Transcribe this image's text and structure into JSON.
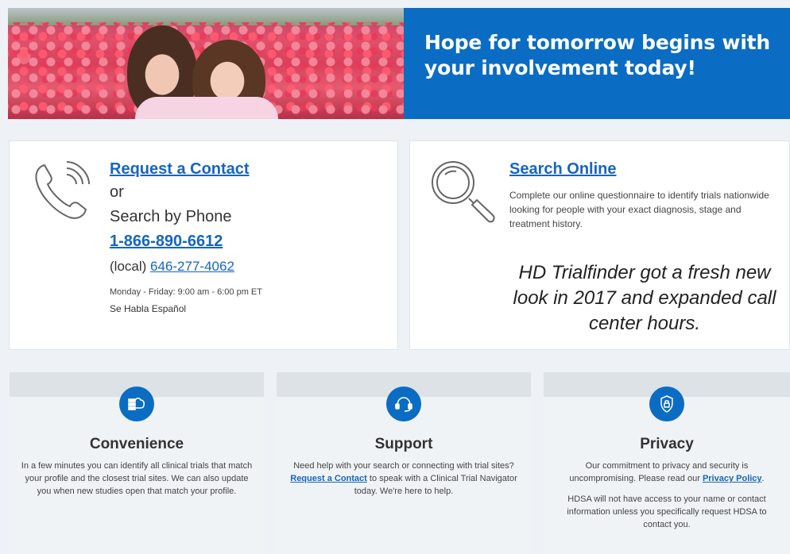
{
  "hero": {
    "headline": "Hope for tomorrow begins with your involvement today!"
  },
  "contact": {
    "request_link": "Request a Contact",
    "or": "or",
    "search_by_phone": "Search by Phone",
    "toll_free": "1-866-890-6612",
    "local_label": "(local)",
    "local_number": "646-277-4062",
    "hours": "Monday - Friday: 9:00 am - 6:00 pm ET",
    "spanish": "Se Habla Español"
  },
  "search": {
    "link": "Search Online",
    "description": "Complete our online questionnaire to identify trials nationwide looking for people with your exact diagnosis, stage and treatment history.",
    "promo": "HD Trialfinder got a fresh new look in 2017 and expanded call center hours."
  },
  "features": {
    "convenience": {
      "title": "Convenience",
      "body": "In a few minutes you can identify all clinical trials that match your profile and the closest trial sites. We can also update you when new studies open that match your profile."
    },
    "support": {
      "title": "Support",
      "body_before": "Need help with your search or connecting with trial sites?",
      "link": "Request a Contact",
      "body_after": "to speak with a Clinical Trial Navigator today. We're here to help."
    },
    "privacy": {
      "title": "Privacy",
      "body_before": "Our commitment to privacy and security is uncompromising. Please read our",
      "link": "Privacy Policy",
      "body_after": ".",
      "body2": "HDSA will not have access to your name or contact information unless you specifically request HDSA to contact you."
    }
  },
  "colors": {
    "brand_blue": "#0b6cc4",
    "link_blue": "#1565c0"
  },
  "icons": {
    "phone": "phone-icon",
    "search": "magnifier-icon",
    "convenience": "cloud-database-icon",
    "support": "headset-icon",
    "privacy": "shield-lock-icon"
  }
}
